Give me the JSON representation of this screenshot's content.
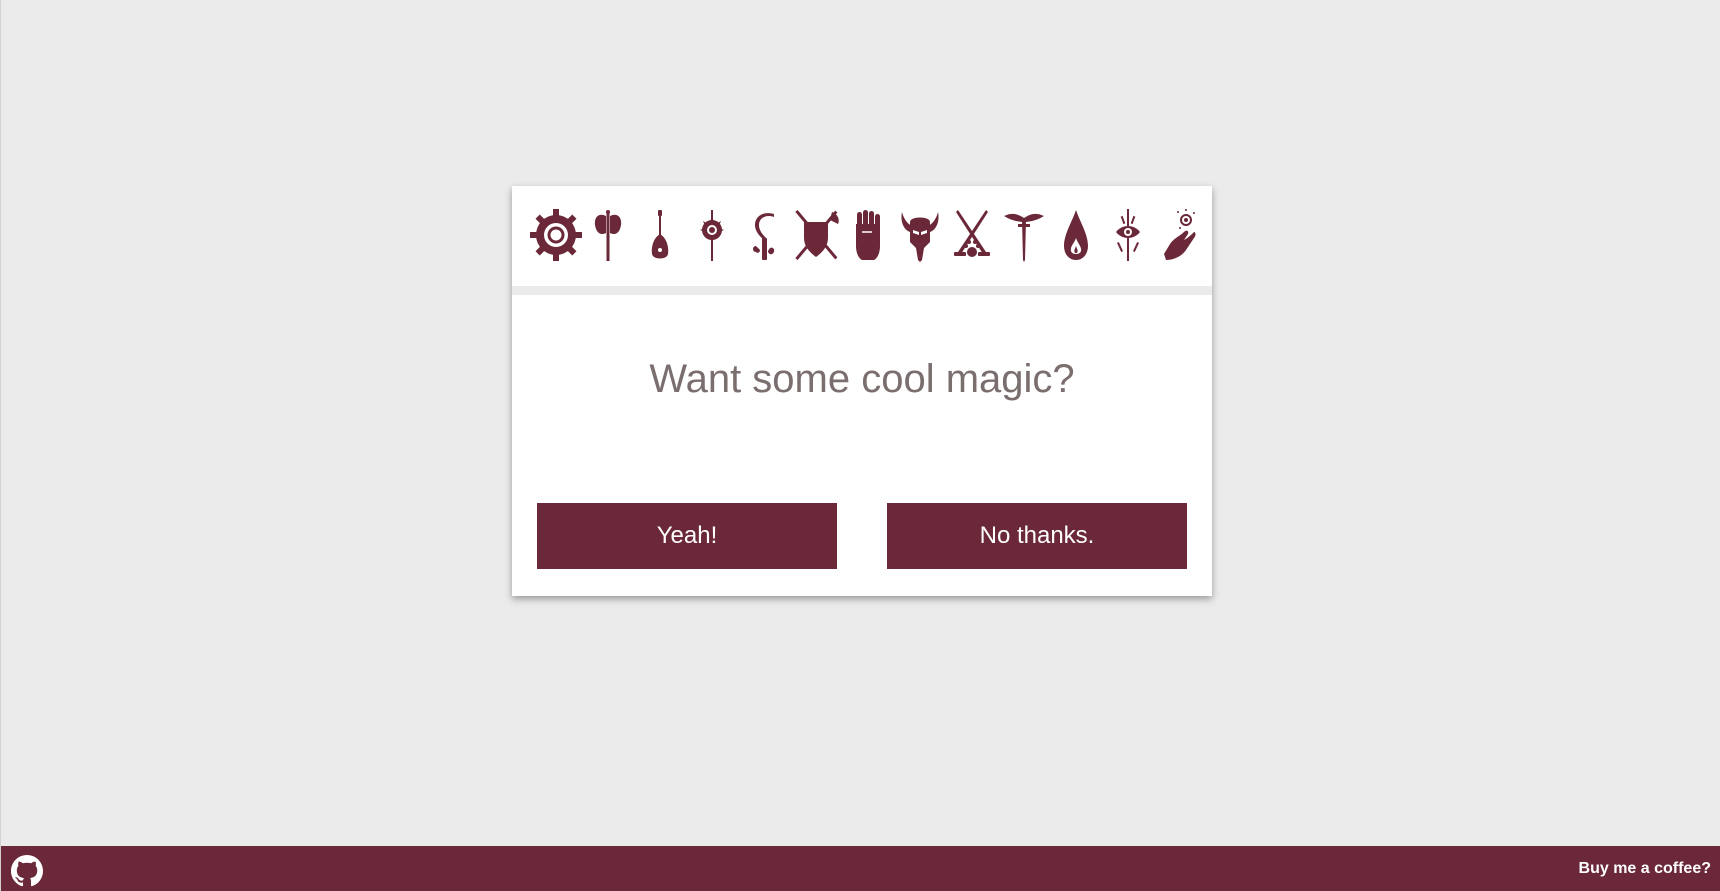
{
  "dialog": {
    "question": "Want some cool magic?",
    "yes_label": "Yeah!",
    "no_label": "No thanks."
  },
  "class_icons": [
    "artificer-gear-icon",
    "barbarian-axe-icon",
    "bard-lute-icon",
    "cleric-mace-icon",
    "druid-sickle-icon",
    "fighter-shield-icon",
    "monk-fist-icon",
    "paladin-helm-icon",
    "ranger-crossed-blades-icon",
    "rogue-dagger-icon",
    "sorcerer-flame-drop-icon",
    "warlock-eye-icon",
    "wizard-hand-icon"
  ],
  "footer": {
    "github_icon": "github-icon",
    "coffee_label": "Buy me a coffee?"
  },
  "colors": {
    "accent": "#6b2838",
    "background": "#ebebeb",
    "card": "#ffffff",
    "question_text": "#7a6e6e"
  }
}
